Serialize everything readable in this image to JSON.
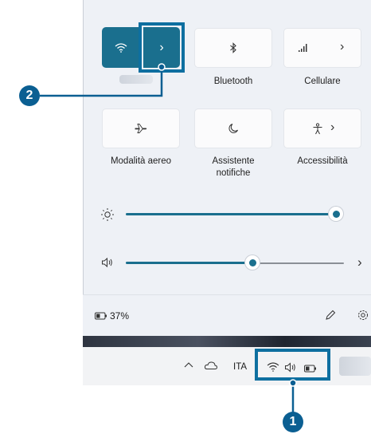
{
  "quick_settings": {
    "tiles_row1": [
      {
        "label": ""
      },
      {
        "label": "Bluetooth"
      },
      {
        "label": "Cellulare"
      }
    ],
    "tiles_row2": [
      {
        "label": "Modalità aereo"
      },
      {
        "label": "Assistente notifiche"
      },
      {
        "label": "Accessibilità"
      }
    ],
    "arrow_glyph": "›",
    "brightness_level": 1.0,
    "volume_level": 0.6
  },
  "footer": {
    "battery_text": "37%"
  },
  "taskbar": {
    "language": "ITA"
  },
  "callouts": {
    "one": "1",
    "two": "2"
  },
  "colors": {
    "accent": "#1a6f8e",
    "callout": "#0b5f92",
    "highlight_border": "#0e6fa0"
  }
}
